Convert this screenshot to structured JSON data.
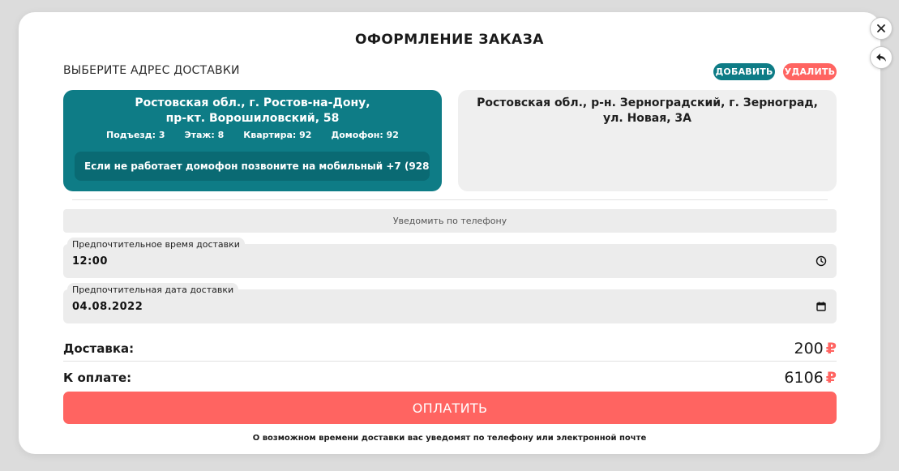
{
  "modal": {
    "title": "ОФОРМЛЕНИЕ ЗАКАЗА",
    "close_icon": "close-icon",
    "back_icon": "back-arrow-icon"
  },
  "address_section": {
    "label": "ВЫБЕРИТЕ АДРЕС ДОСТАВКИ",
    "add_label": "ДОБАВИТЬ",
    "delete_label": "УДАЛИТЬ",
    "colors": {
      "accent": "#0e7c86",
      "danger": "#ff6461"
    }
  },
  "addresses": [
    {
      "line1": "Ростовская обл., г. Ростов-на-Дону,",
      "line2": "пр-кт. Ворошиловский,  58",
      "entrance": "Подъезд: 3",
      "floor": "Этаж: 8",
      "apartment": "Квартира: 92",
      "intercom": "Домофон: 92",
      "note": "Если не работает домофон позвоните на мобильный +7 (928",
      "selected": true
    },
    {
      "line1": "Ростовская обл., р-н. Зерноградский, г. Зерноград,",
      "line2": "ул. Новая,  3А",
      "selected": false
    }
  ],
  "notify_label": "Уведомить по телефону",
  "time_field": {
    "label": "Предпочтительное время доставки",
    "value": "12:00",
    "icon": "clock-icon"
  },
  "date_field": {
    "label": "Предпочтительная дата доставки",
    "value": "04.08.2022",
    "icon": "calendar-icon"
  },
  "summary": {
    "delivery_label": "Доставка:",
    "delivery_value": "200",
    "total_label": "К оплате:",
    "total_value": "6106",
    "currency": "₽"
  },
  "pay_label": "ОПЛАТИТЬ",
  "footnote": "О возможном времени доставки вас уведомят по телефону или электронной почте"
}
